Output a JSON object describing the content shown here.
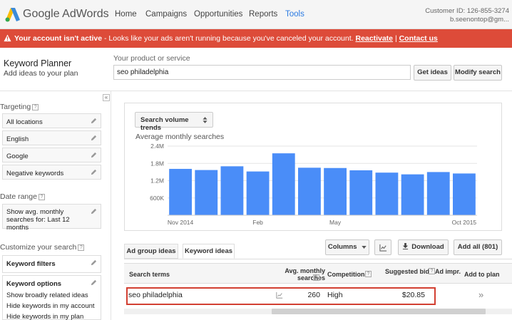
{
  "header": {
    "brand": "Google AdWords",
    "nav": [
      "Home",
      "Campaigns",
      "Opportunities",
      "Reports",
      "Tools"
    ],
    "active_nav": "Tools",
    "customer_id": "Customer ID: 126-855-3274",
    "email": "b.seenontop@gm..."
  },
  "alert": {
    "title": "Your account isn't active",
    "message": " - Looks like your ads aren't running because you've canceled your account. ",
    "reactivate": "Reactivate",
    "sep": "|",
    "contact": "Contact us"
  },
  "planner": {
    "title": "Keyword Planner",
    "subtitle": "Add ideas to your plan",
    "product_label": "Your product or service",
    "product_value": "seo philadelphia",
    "get_ideas": "Get ideas",
    "modify_search": "Modify search"
  },
  "sidebar": {
    "targeting_label": "Targeting",
    "targeting_items": [
      "All locations",
      "English",
      "Google",
      "Negative keywords"
    ],
    "date_range_label": "Date range",
    "date_range_value": "Show avg. monthly searches for: Last 12 months",
    "customize_label": "Customize your search",
    "keyword_filters": "Keyword filters",
    "keyword_options": "Keyword options",
    "keyword_option_items": [
      "Show broadly related ideas",
      "Hide keywords in my account",
      "Hide keywords in my plan"
    ]
  },
  "chart_panel": {
    "trend_button": "Search volume trends",
    "title": "Average monthly searches"
  },
  "chart_data": {
    "type": "bar",
    "title": "Average monthly searches",
    "categories": [
      "Nov 2014",
      "Dec 2014",
      "Jan 2015",
      "Feb 2015",
      "Mar 2015",
      "Apr 2015",
      "May 2015",
      "Jun 2015",
      "Jul 2015",
      "Aug 2015",
      "Sep 2015",
      "Oct 2015"
    ],
    "x_tick_labels": [
      "Nov 2014",
      "Feb",
      "May",
      "Oct 2015"
    ],
    "x_tick_indices": [
      0,
      3,
      6,
      11
    ],
    "values": [
      1610000,
      1570000,
      1700000,
      1520000,
      2150000,
      1650000,
      1640000,
      1560000,
      1480000,
      1420000,
      1500000,
      1450000
    ],
    "ylim": [
      0,
      2500000
    ],
    "yticks": [
      600000,
      1200000,
      1800000,
      2400000
    ],
    "ytick_labels": [
      "600K",
      "1.2M",
      "1.8M",
      "2.4M"
    ],
    "bar_color": "#4a8df8",
    "grid": true
  },
  "tabs": [
    "Ad group ideas",
    "Keyword ideas"
  ],
  "active_tab": "Keyword ideas",
  "toolbar": {
    "columns": "Columns",
    "download": "Download",
    "add_all": "Add all (801)"
  },
  "table": {
    "headers": [
      "Search terms",
      "Avg. monthly searches",
      "Competition",
      "Suggested bid",
      "Ad impr.",
      "Add to plan"
    ],
    "rows": [
      {
        "term": "seo philadelphia",
        "searches": "260",
        "competition": "High",
        "bid": "$20.85",
        "add": "»"
      }
    ]
  },
  "colors": {
    "accent": "#2a7ae2",
    "alert": "#dd4b39",
    "bar": "#4a8df8",
    "highlight": "#d23f31"
  }
}
